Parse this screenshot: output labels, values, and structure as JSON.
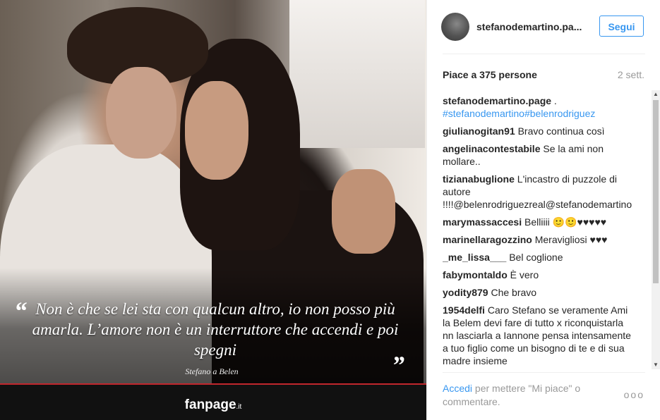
{
  "post": {
    "quote_open": "“",
    "quote_text": "Non è che se lei sta con qualcun altro, io non posso più amarla. L’amore non è un interruttore che accendi e poi spegni",
    "quote_close": "”",
    "quote_author": "Stefano a Belen",
    "brand": "fanpage",
    "brand_suffix": ".it"
  },
  "header": {
    "username": "stefanodemartino.pa...",
    "follow_label": "Segui"
  },
  "stats": {
    "likes": "Piace a 375 persone",
    "time_ago": "2 sett."
  },
  "comments": [
    {
      "user": "stefanodemartino.page",
      "text": " .",
      "hashtags": "#stefanodemartino#belenrodriguez"
    },
    {
      "user": "giulianogitan91",
      "text": "Bravo continua così"
    },
    {
      "user": "angelinacontestabile",
      "text": "Se la ami non mollare.."
    },
    {
      "user": "tizianabuglione",
      "text": "L'incastro di puzzole di autore !!!!@belenrodriguezreal@stefanodemartino"
    },
    {
      "user": "marymassaccesi",
      "text": "Belliiii 🙂🙂♥♥♥♥♥"
    },
    {
      "user": "marinellaragozzino",
      "text": "Meravigliosi ♥♥♥"
    },
    {
      "user": "_me_lissa___",
      "text": "Bel coglione"
    },
    {
      "user": "fabymontaldo",
      "text": "È vero"
    },
    {
      "user": "yodity879",
      "text": "Che bravo"
    },
    {
      "user": "1954delfi",
      "text": "Caro Stefano se veramente Ami la Belem devi fare di tutto x riconquistarla nn lasciarla a Iannone pensa intensamente a tuo figlio come un bisogno di te e di sua madre insieme"
    }
  ],
  "footer": {
    "login_link": "Accedi",
    "login_rest": " per mettere \"Mi piace\" o commentare.",
    "more": "ooo"
  },
  "colors": {
    "link_blue": "#3897f0",
    "brand_red": "#c1272d",
    "text_dark": "#262626",
    "text_grey": "#999999"
  },
  "icons": {
    "avatar": "profile-photo",
    "more": "more-options-icon",
    "scroll_up": "scroll-up-arrow",
    "scroll_down": "scroll-down-arrow"
  }
}
